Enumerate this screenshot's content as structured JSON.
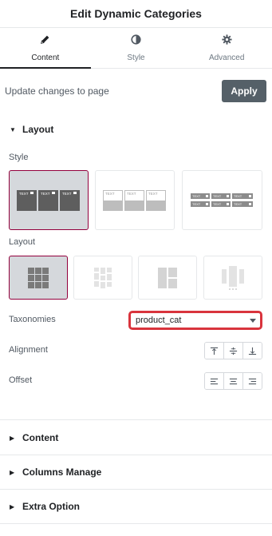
{
  "header": {
    "title": "Edit Dynamic Categories"
  },
  "tabs": [
    {
      "label": "Content",
      "icon": "pencil-icon"
    },
    {
      "label": "Style",
      "icon": "half-circle-icon"
    },
    {
      "label": "Advanced",
      "icon": "gear-icon"
    }
  ],
  "update": {
    "text": "Update changes to page",
    "apply_label": "Apply"
  },
  "sections": {
    "layout": "Layout",
    "content": "Content",
    "columns": "Columns Manage",
    "extra": "Extra Option"
  },
  "labels": {
    "style": "Style",
    "layout": "Layout",
    "taxonomies": "Taxonomies",
    "alignment": "Alignment",
    "offset": "Offset"
  },
  "style_thumbs": {
    "thumb1": [
      "TEXT",
      "TEXT",
      "TEXT"
    ],
    "thumb2": [
      "TEXT",
      "TEXT",
      "TEXT"
    ],
    "thumb3": [
      "TEXT",
      "TEXT",
      "TEXT",
      "TEXT",
      "TEXT",
      "TEXT"
    ]
  },
  "taxonomies": {
    "value": "product_cat"
  },
  "colors": {
    "accent": "#93003c",
    "highlight": "#d9343d",
    "apply_bg": "#556068"
  }
}
